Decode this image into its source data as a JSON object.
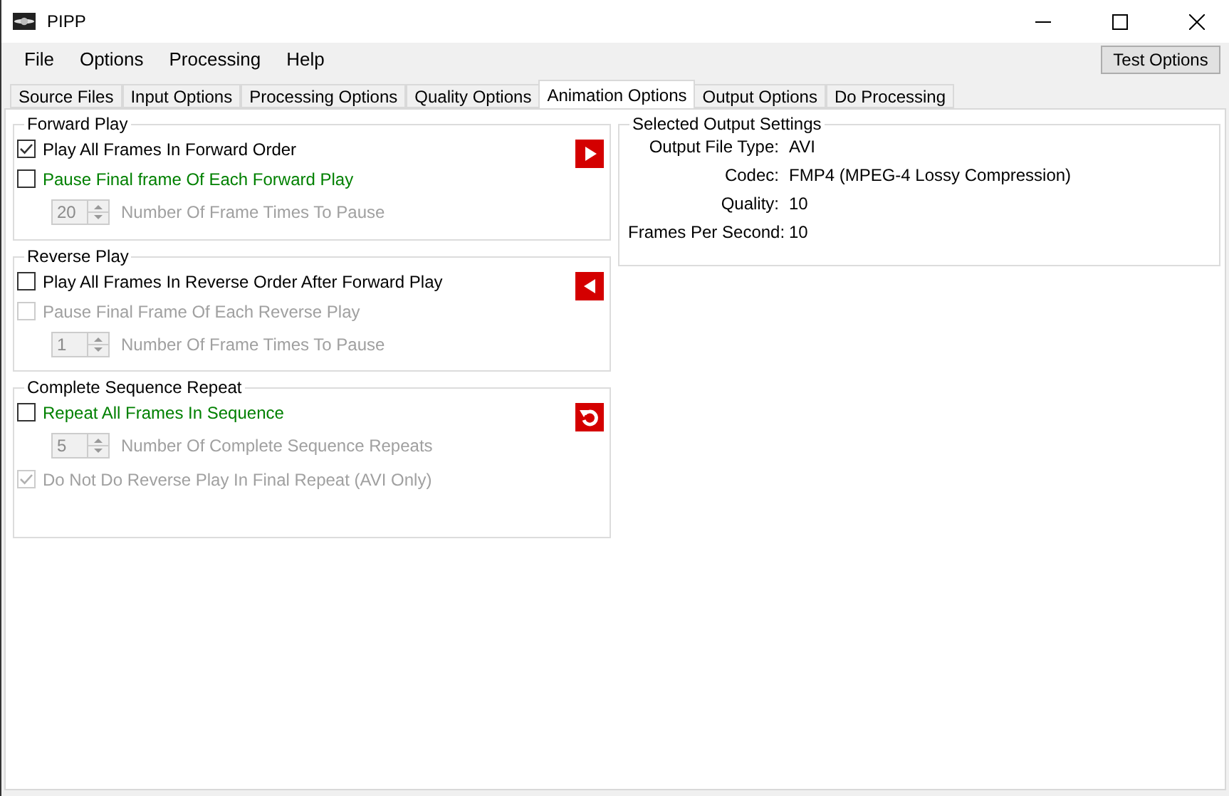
{
  "window": {
    "title": "PIPP"
  },
  "menu": [
    "File",
    "Options",
    "Processing",
    "Help"
  ],
  "test_button": "Test Options",
  "tabs": [
    {
      "label": "Source Files",
      "selected": false
    },
    {
      "label": "Input Options",
      "selected": false
    },
    {
      "label": "Processing Options",
      "selected": false
    },
    {
      "label": "Quality Options",
      "selected": false
    },
    {
      "label": "Animation Options",
      "selected": true
    },
    {
      "label": "Output Options",
      "selected": false
    },
    {
      "label": "Do Processing",
      "selected": false
    }
  ],
  "groups": [
    {
      "title": "Forward Play",
      "kind": "play",
      "rows": [
        {
          "kind": "checkbox",
          "label": "Play All Frames In Forward Order",
          "checked": true,
          "disabled": false,
          "highlighted": false
        },
        {
          "kind": "checkbox",
          "label": "Pause Final frame Of Each Forward Play",
          "checked": false,
          "disabled": false,
          "highlighted": true
        },
        {
          "kind": "spinner",
          "value": "20",
          "caption": "Number Of Frame Times To Pause",
          "disabled": true
        }
      ]
    },
    {
      "title": "Reverse Play",
      "kind": "reverse",
      "rows": [
        {
          "kind": "checkbox",
          "label": "Play All Frames In Reverse Order After Forward Play",
          "checked": false,
          "disabled": false,
          "highlighted": false
        },
        {
          "kind": "checkbox",
          "label": "Pause Final Frame Of Each Reverse Play",
          "checked": false,
          "disabled": true,
          "highlighted": false
        },
        {
          "kind": "spinner",
          "value": "1",
          "caption": "Number Of Frame Times To Pause",
          "disabled": true
        }
      ]
    },
    {
      "title": "Complete Sequence Repeat",
      "kind": "repeat",
      "rows": [
        {
          "kind": "checkbox",
          "label": "Repeat All Frames In Sequence",
          "checked": false,
          "disabled": false,
          "highlighted": true
        },
        {
          "kind": "spinner",
          "value": "5",
          "caption": "Number Of Complete Sequence Repeats",
          "disabled": true
        },
        {
          "kind": "checkbox",
          "label": "Do Not Do Reverse Play In Final Repeat (AVI Only)",
          "checked": true,
          "disabled": true,
          "highlighted": false
        }
      ]
    }
  ],
  "output_settings": {
    "title": "Selected Output Settings",
    "rows": [
      {
        "label": "Output File Type:",
        "value": "AVI"
      },
      {
        "label": "Codec:",
        "value": "FMP4 (MPEG-4 Lossy Compression)"
      },
      {
        "label": "Quality:",
        "value": "10"
      },
      {
        "label": "Frames Per Second:",
        "value": "10"
      }
    ]
  }
}
